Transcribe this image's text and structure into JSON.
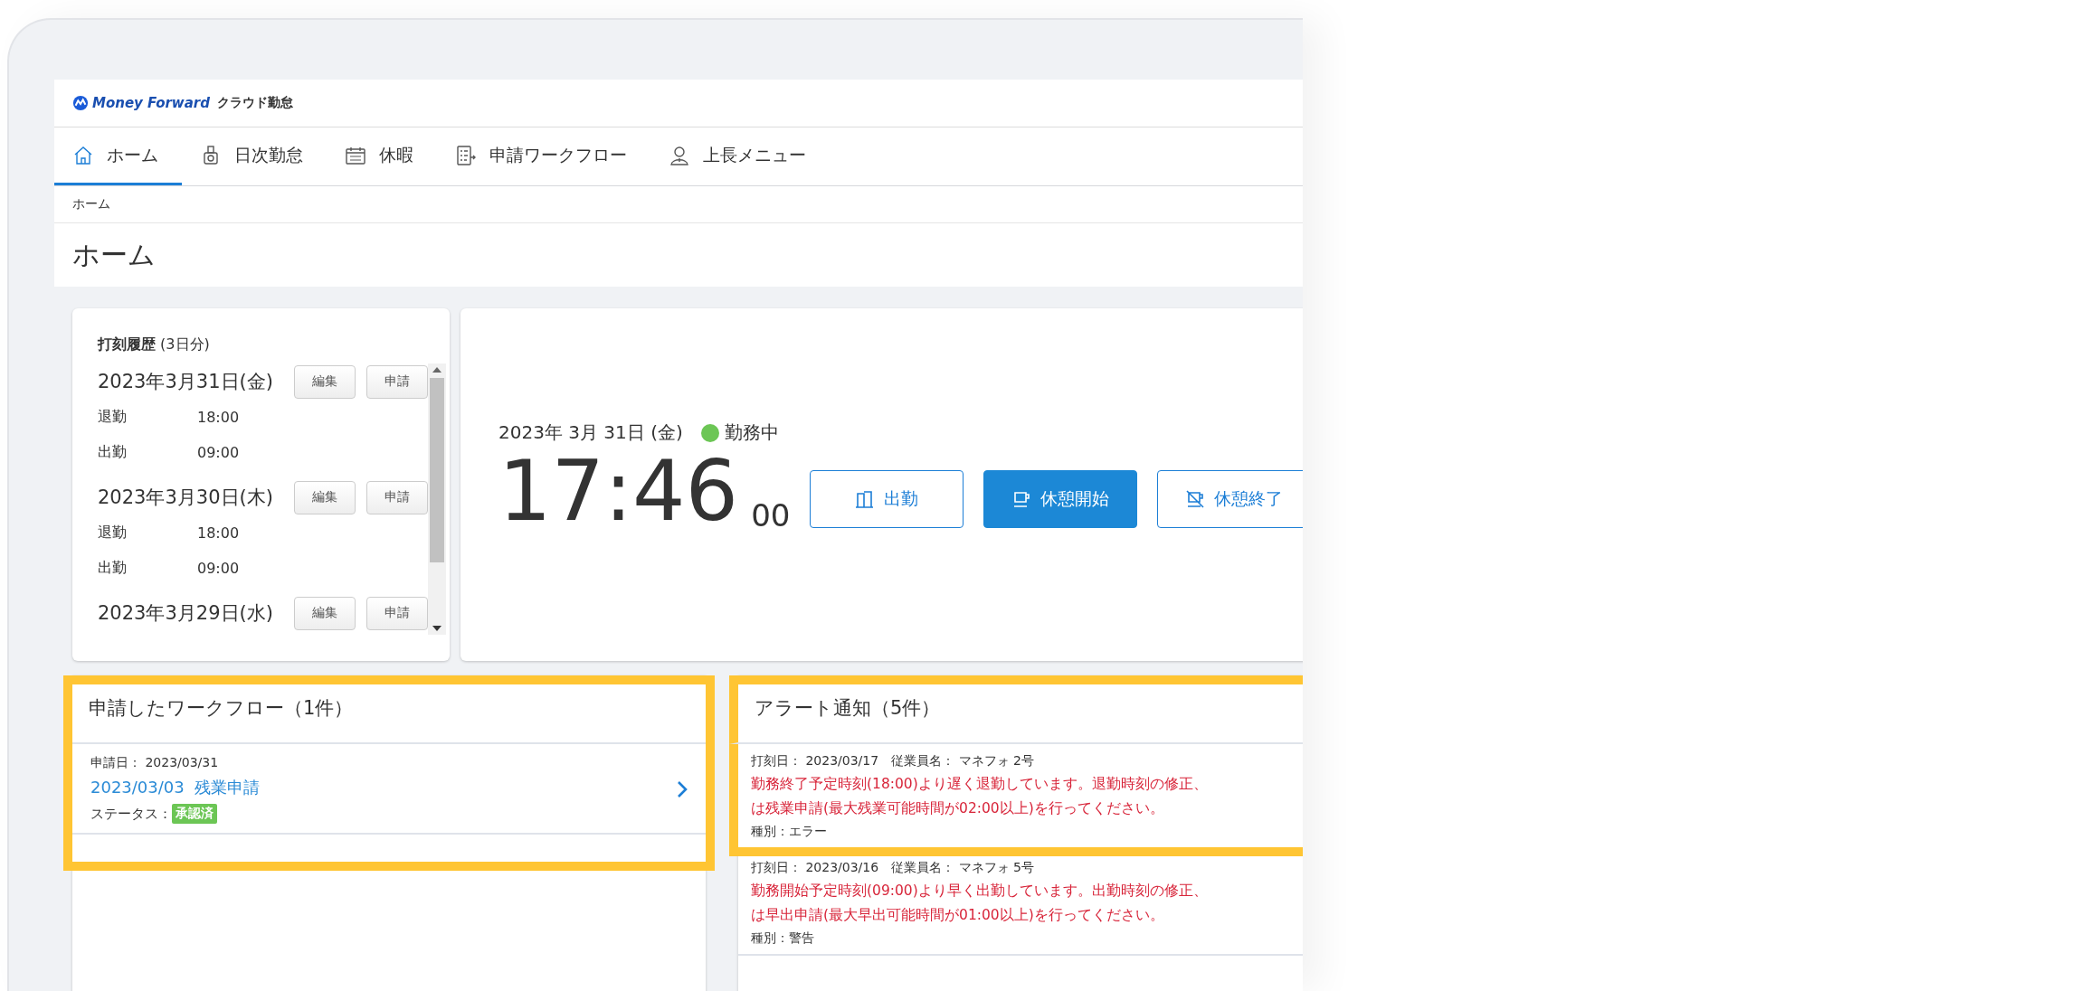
{
  "logo": {
    "brand": "Money Forward",
    "product": "クラウド勤怠"
  },
  "nav": [
    {
      "label": "ホーム",
      "selected": true
    },
    {
      "label": "日次勤怠",
      "selected": false
    },
    {
      "label": "休暇",
      "selected": false
    },
    {
      "label": "申請ワークフロー",
      "selected": false
    },
    {
      "label": "上長メニュー",
      "selected": false
    }
  ],
  "breadcrumb": [
    "ホーム"
  ],
  "page_title": "ホーム",
  "punch_history": {
    "title": "打刻履歴",
    "subtitle": "(3日分)",
    "days": [
      {
        "date": "2023年3月31日(金)",
        "buttons": [
          "編集",
          "申請"
        ],
        "entries": [
          {
            "label": "退勤",
            "time": "18:00"
          },
          {
            "label": "出勤",
            "time": "09:00"
          }
        ]
      },
      {
        "date": "2023年3月30日(木)",
        "buttons": [
          "編集",
          "申請"
        ],
        "entries": [
          {
            "label": "退勤",
            "time": "18:00"
          },
          {
            "label": "出勤",
            "time": "09:00"
          }
        ]
      },
      {
        "date": "2023年3月29日(水)",
        "buttons": [
          "編集",
          "申請"
        ]
      }
    ]
  },
  "clock": {
    "date": "2023年 3月 31日 (金)",
    "status": "勤務中",
    "time": "17:46",
    "seconds": "00",
    "buttons": [
      {
        "label": "出勤",
        "kind": "outline"
      },
      {
        "label": "休憩開始",
        "kind": "primary"
      },
      {
        "label": "休憩終了",
        "kind": "outline"
      }
    ]
  },
  "workflow": {
    "title": "申請したワークフロー（1件）",
    "items": [
      {
        "highlighted": true,
        "date_label": "申請日：",
        "date": "2023/03/31",
        "link": "2023/03/03  残業申請",
        "status_label": "ステータス：",
        "status": "承認済"
      }
    ]
  },
  "alerts": {
    "title": "アラート通知（5件）",
    "items": [
      {
        "highlighted": true,
        "meta": "打刻日： 2023/03/17　従業員名： マネフォ 2号",
        "lines": [
          "勤務終了予定時刻(18:00)より遅く退勤しています。退勤時刻の修正、",
          "は残業申請(最大残業可能時間が02:00以上)を行ってください。"
        ],
        "type": "種別：エラー"
      },
      {
        "highlighted": false,
        "meta": "打刻日： 2023/03/16　従業員名： マネフォ 5号",
        "lines": [
          "勤務開始予定時刻(09:00)より早く出勤しています。出勤時刻の修正、",
          "は早出申請(最大早出可能時間が01:00以上)を行ってください。"
        ],
        "type": "種別：警告"
      }
    ]
  }
}
